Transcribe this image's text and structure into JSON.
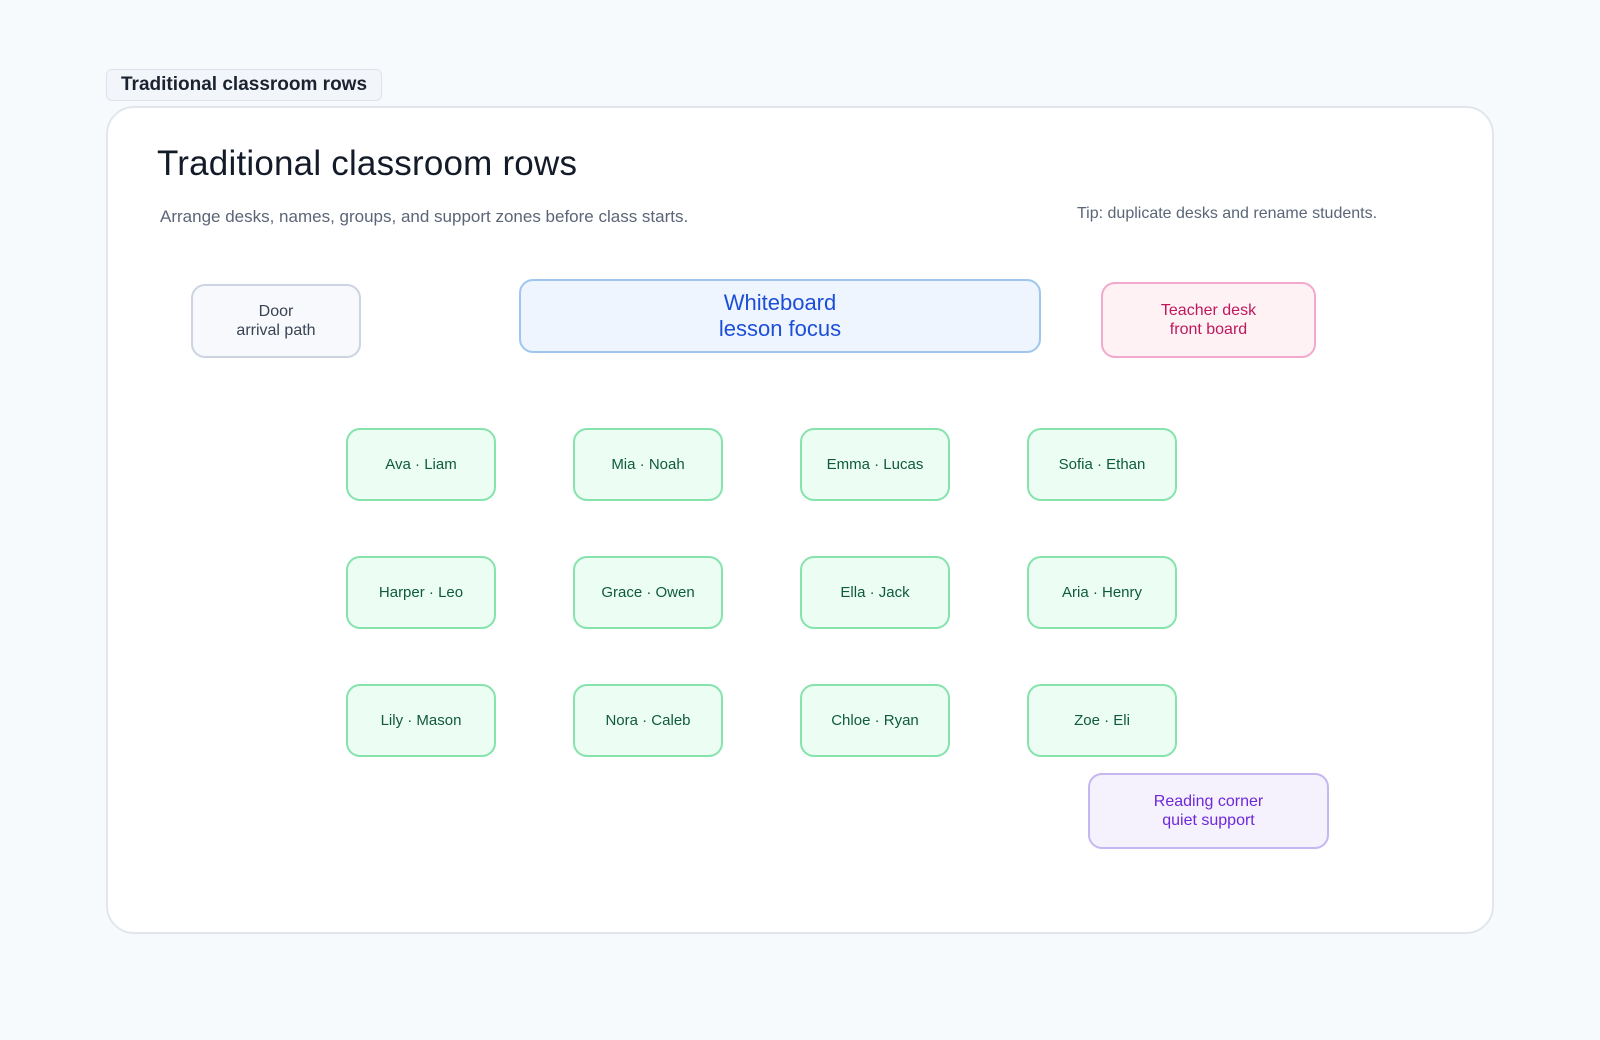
{
  "frame_tab": "Traditional classroom rows",
  "page": {
    "title": "Traditional classroom rows",
    "subtitle": "Arrange desks, names, groups, and support zones before class starts.",
    "tip": "Tip: duplicate desks and rename students."
  },
  "zones": {
    "door": {
      "line1": "Door",
      "line2": "arrival path"
    },
    "whiteboard": {
      "line1": "Whiteboard",
      "line2": "lesson focus"
    },
    "teacher_desk": {
      "line1": "Teacher desk",
      "line2": "front board"
    },
    "reading_corner": {
      "line1": "Reading corner",
      "line2": "quiet support"
    }
  },
  "desk_rows": [
    [
      "Ava · Liam",
      "Mia · Noah",
      "Emma · Lucas",
      "Sofia · Ethan"
    ],
    [
      "Harper · Leo",
      "Grace · Owen",
      "Ella · Jack",
      "Aria · Henry"
    ],
    [
      "Lily · Mason",
      "Nora · Caleb",
      "Chloe · Ryan",
      "Zoe · Eli"
    ]
  ]
}
